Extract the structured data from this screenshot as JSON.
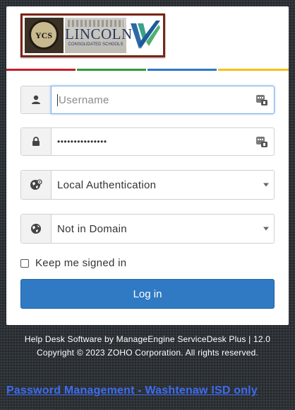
{
  "logos": {
    "ycs_text": "YCS",
    "lincoln_name": "LINCOLN",
    "lincoln_sub": "CONSOLIDATED SCHOOLS"
  },
  "accent_colors": [
    "#c0202a",
    "#2f9a3a",
    "#2d79c2",
    "#f2c21a"
  ],
  "form": {
    "username_placeholder": "Username",
    "password_value": "•••••••••••••••",
    "auth_method": "Local Authentication",
    "domain": "Not in Domain",
    "remember_label": "Keep me signed in",
    "remember_checked": false,
    "login_label": "Log in"
  },
  "footer": {
    "line1": "Help Desk Software by ManageEngine ServiceDesk Plus | 12.0",
    "line2": "Copyright © 2023 ZOHO Corporation. All rights reserved."
  },
  "link": {
    "password_management": "Password Management  - Washtenaw ISD only"
  }
}
